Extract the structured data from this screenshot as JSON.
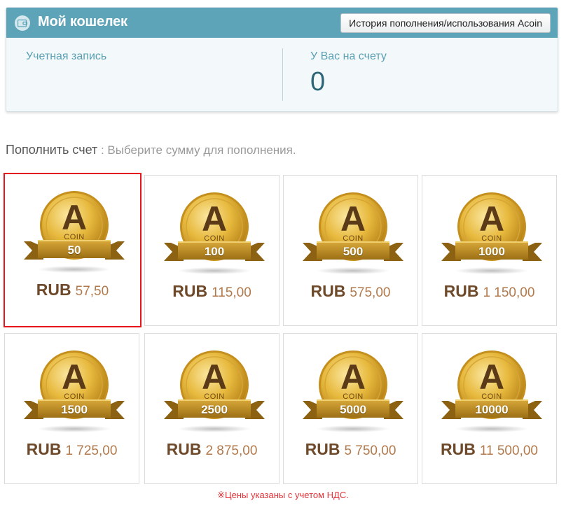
{
  "wallet": {
    "title": "Мой кошелек",
    "history_button": "История пополнения/использования Acoin",
    "account_label": "Учетная запись",
    "balance_label": "У Вас на счету",
    "balance_value": "0"
  },
  "topup": {
    "title": "Пополнить счет",
    "hint": " : Выберите сумму для пополнения."
  },
  "packages": [
    {
      "coin_letter": "A",
      "coin_word": "COIN",
      "amount": "50",
      "currency": "RUB",
      "price": "57,50"
    },
    {
      "coin_letter": "A",
      "coin_word": "COIN",
      "amount": "100",
      "currency": "RUB",
      "price": "115,00"
    },
    {
      "coin_letter": "A",
      "coin_word": "COIN",
      "amount": "500",
      "currency": "RUB",
      "price": "575,00"
    },
    {
      "coin_letter": "A",
      "coin_word": "COIN",
      "amount": "1000",
      "currency": "RUB",
      "price": "1 150,00"
    },
    {
      "coin_letter": "A",
      "coin_word": "COIN",
      "amount": "1500",
      "currency": "RUB",
      "price": "1 725,00"
    },
    {
      "coin_letter": "A",
      "coin_word": "COIN",
      "amount": "2500",
      "currency": "RUB",
      "price": "2 875,00"
    },
    {
      "coin_letter": "A",
      "coin_word": "COIN",
      "amount": "5000",
      "currency": "RUB",
      "price": "5 750,00"
    },
    {
      "coin_letter": "A",
      "coin_word": "COIN",
      "amount": "10000",
      "currency": "RUB",
      "price": "11 500,00"
    }
  ],
  "selected_package": "50",
  "vat_note": "※Цены указаны с учетом НДС.",
  "colors": {
    "header": "#5ea4b8",
    "label": "#5a9fb3",
    "balance": "#2d6579",
    "selected_border": "#e8141c",
    "currency": "#6e4a2a",
    "price": "#b27a4c",
    "note": "#e2343a"
  },
  "icons": {
    "wallet": "wallet-icon",
    "coin": "acoin-icon"
  }
}
